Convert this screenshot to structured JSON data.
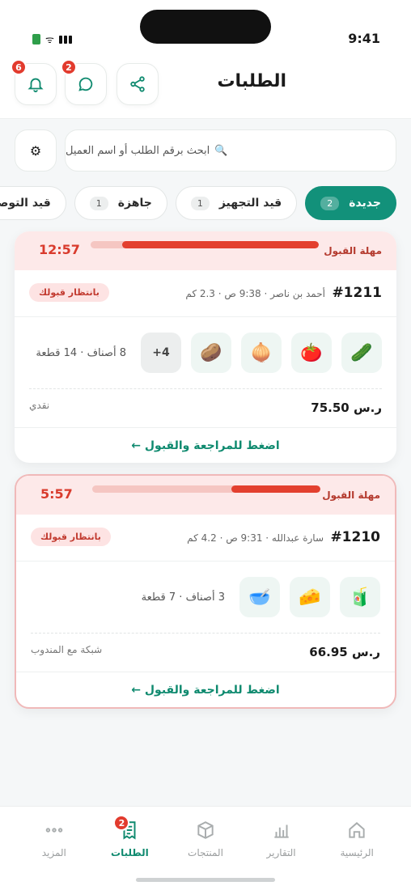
{
  "status_bar": {
    "time": "9:41"
  },
  "header": {
    "title": "الطلبات",
    "notifications_count": "6",
    "messages_count": "2"
  },
  "search": {
    "placeholder": "ابحث برقم الطلب أو اسم العميل",
    "icon": "search-icon"
  },
  "settings": {
    "icon": "⚙"
  },
  "tabs": [
    {
      "label": "جديدة",
      "count": "2",
      "active": true
    },
    {
      "label": "قيد التجهيز",
      "count": "1"
    },
    {
      "label": "جاهزة",
      "count": "1"
    },
    {
      "label": "قيد التوصيل"
    }
  ],
  "orders": [
    {
      "deadline_label": "مهلة القبول",
      "deadline_time": "12:57",
      "deadline_progress": 0.86,
      "order_id": "#1211",
      "meta": "أحمد بن ناصر · 9:38 ص · 2.3 كم",
      "status": "بانتظار قبولك",
      "items": [
        "🥒",
        "🍅",
        "🧅",
        "🥔"
      ],
      "more": "+4",
      "summary": "8 أصناف · 14 قطعة",
      "price": "75.50 ر.س",
      "payment": "نقدي",
      "action": "اضغط للمراجعة والقبول ←"
    },
    {
      "deadline_label": "مهلة القبول",
      "deadline_time": "5:57",
      "deadline_progress": 0.39,
      "order_id": "#1210",
      "meta": "سارة عبدالله · 9:31 ص · 4.2 كم",
      "status": "بانتظار قبولك",
      "items": [
        "🧃",
        "🧀",
        "🥣"
      ],
      "summary": "3 أصناف · 7 قطعة",
      "price": "66.95 ر.س",
      "payment": "شبكة مع المندوب",
      "action": "اضغط للمراجعة والقبول ←"
    }
  ],
  "bottom_nav": [
    {
      "label": "الرئيسية",
      "icon": "home-icon"
    },
    {
      "label": "التقارير",
      "icon": "chart-icon"
    },
    {
      "label": "المنتجات",
      "icon": "box-icon"
    },
    {
      "label": "الطلبات",
      "icon": "receipt-icon",
      "active": true,
      "badge": "2"
    },
    {
      "label": "المزيد",
      "icon": "more-icon"
    }
  ]
}
